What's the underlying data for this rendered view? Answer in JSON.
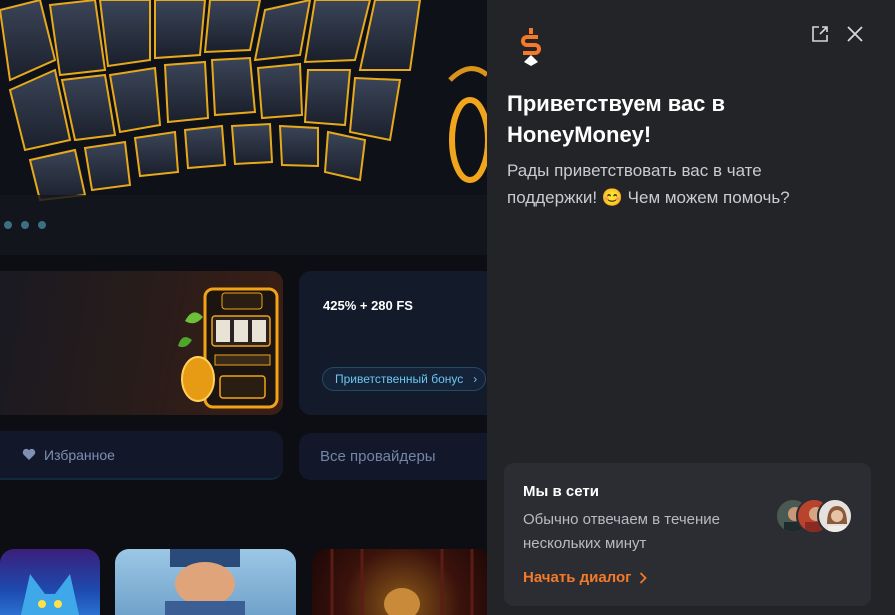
{
  "site": {
    "bonus": {
      "title": "425% + 280 FS",
      "button_label": "Приветственный бонус"
    },
    "favorites_label": "Избранное",
    "providers_label": "Все провайдеры"
  },
  "chat": {
    "greeting_title": "Приветствуем вас в HoneyMoney!",
    "greeting_text": "Рады приветствовать вас в чате поддержки! 😊  Чем можем помочь?",
    "status": {
      "title": "Мы в сети",
      "text": "Обычно отвечаем в течение нескольких минут",
      "start_label": "Начать диалог"
    }
  },
  "colors": {
    "accent": "#f47a2a",
    "panel_bg": "#232428",
    "card_bg": "#2c2d33",
    "bonus_link": "#6cc6f0"
  },
  "icons": [
    "honeymoney-logo-icon",
    "open-external-icon",
    "close-icon",
    "heart-icon",
    "chevron-right-icon"
  ]
}
